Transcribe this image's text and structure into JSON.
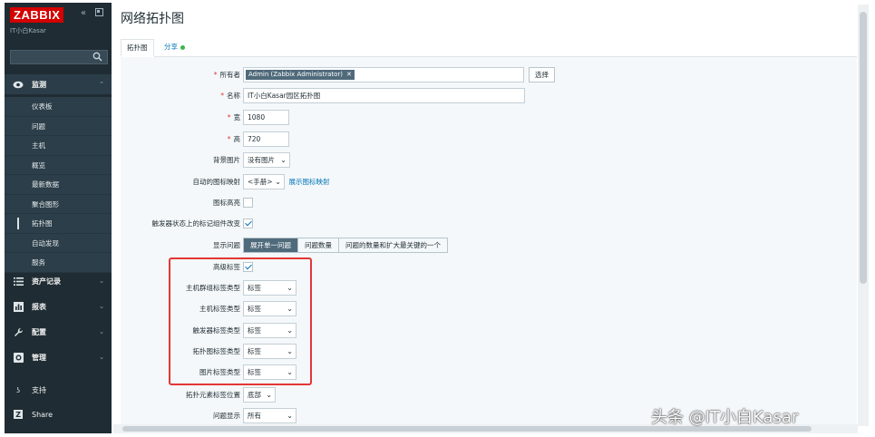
{
  "app": {
    "logo": "ZABBIX",
    "collapse_icon": "«",
    "org_name": "IT小白Kasar"
  },
  "sidebar": {
    "monitoring": "监测",
    "sub_items": [
      "仪表板",
      "问题",
      "主机",
      "概览",
      "最新数据",
      "聚合图形",
      "拓扑图",
      "自动发现",
      "服务"
    ],
    "inventory": "资产记录",
    "reports": "报表",
    "configuration": "配置",
    "administration": "管理",
    "support": "支持",
    "share": "Share"
  },
  "header": {
    "title": "网络拓扑图"
  },
  "tabs": {
    "map": "拓扑图",
    "sharing": "分享"
  },
  "form": {
    "owner": {
      "label": "所有者",
      "chip": "Admin (Zabbix Administrator)",
      "select_button": "选择"
    },
    "name": {
      "label": "名称",
      "value": "IT小白Kasar园区拓扑图"
    },
    "width": {
      "label": "宽",
      "value": "1080"
    },
    "height": {
      "label": "高",
      "value": "720"
    },
    "background": {
      "label": "背景图片",
      "value": "没有图片"
    },
    "icon_mapping": {
      "label": "自动的图标映射",
      "value": "<手册>",
      "link": "展示图标映射"
    },
    "icon_highlight": {
      "label": "图标高亮"
    },
    "mark_elements": {
      "label": "触发器状态上的标记组件改变"
    },
    "display_problems": {
      "label": "显示问题",
      "options": [
        "展开单一问题",
        "问题数量",
        "问题的数量和扩大最关键的一个"
      ],
      "selected": 0
    },
    "advanced_labels": {
      "label": "高级标签"
    },
    "host_group_label_type": {
      "label": "主机群组标签类型",
      "value": "标签"
    },
    "host_label_type": {
      "label": "主机标签类型",
      "value": "标签"
    },
    "trigger_label_type": {
      "label": "触发器标签类型",
      "value": "标签"
    },
    "map_label_type": {
      "label": "拓扑图标签类型",
      "value": "标签"
    },
    "image_label_type": {
      "label": "图片标签类型",
      "value": "标签"
    },
    "label_location": {
      "label": "拓扑元素标签位置",
      "value": "底部"
    },
    "problem_display": {
      "label": "问题显示",
      "value": "所有"
    }
  },
  "watermark": "头条 @IT小白Kasar",
  "colors": {
    "brand": "#d40000",
    "sidebar_bg": "#1f2c33",
    "accent": "#0275b8",
    "highlight": "#e33734"
  }
}
